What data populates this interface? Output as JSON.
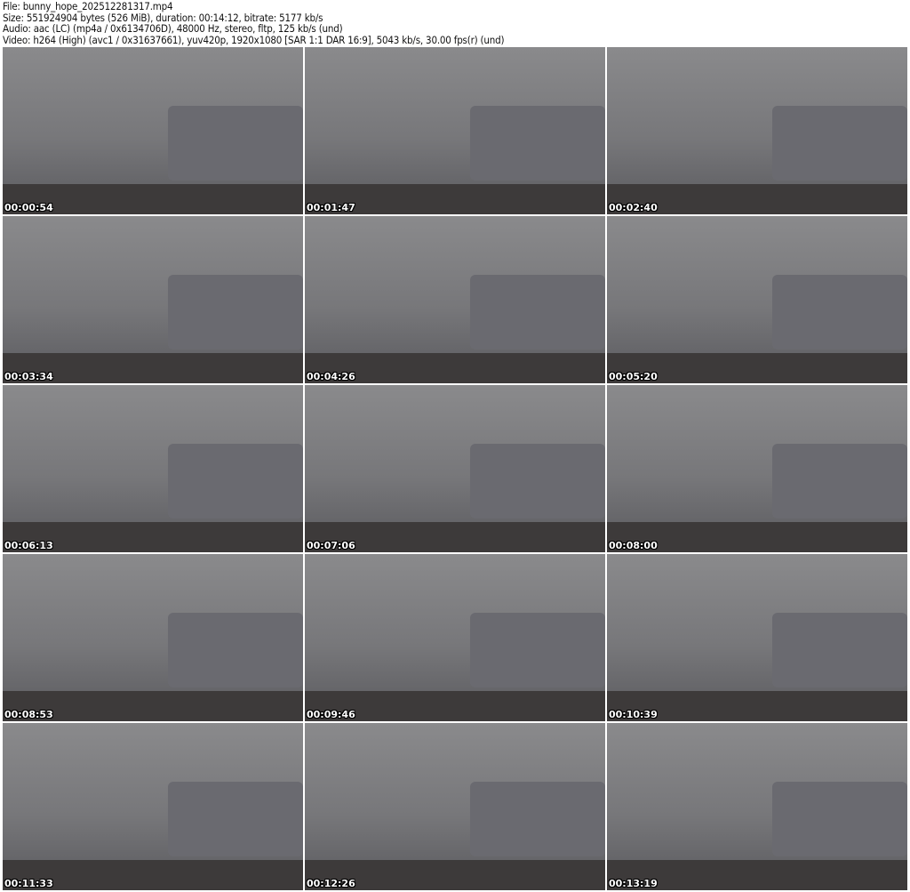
{
  "header": {
    "file": "File: bunny_hope_202512281317.mp4",
    "size": "Size: 551924904 bytes (526 MiB), duration: 00:14:12, bitrate: 5177 kb/s",
    "audio": "Audio: aac (LC) (mp4a / 0x6134706D), 48000 Hz, stereo, fltp, 125 kb/s (und)",
    "video": "Video: h264 (High) (avc1 / 0x31637661), yuv420p, 1920x1080 [SAR 1:1 DAR 16:9], 5043 kb/s, 30.00 fps(r) (und)"
  },
  "thumbnails": [
    "00:00:54",
    "00:01:47",
    "00:02:40",
    "00:03:34",
    "00:04:26",
    "00:05:20",
    "00:06:13",
    "00:07:06",
    "00:08:00",
    "00:08:53",
    "00:09:46",
    "00:10:39",
    "00:11:33",
    "00:12:26",
    "00:13:19"
  ]
}
